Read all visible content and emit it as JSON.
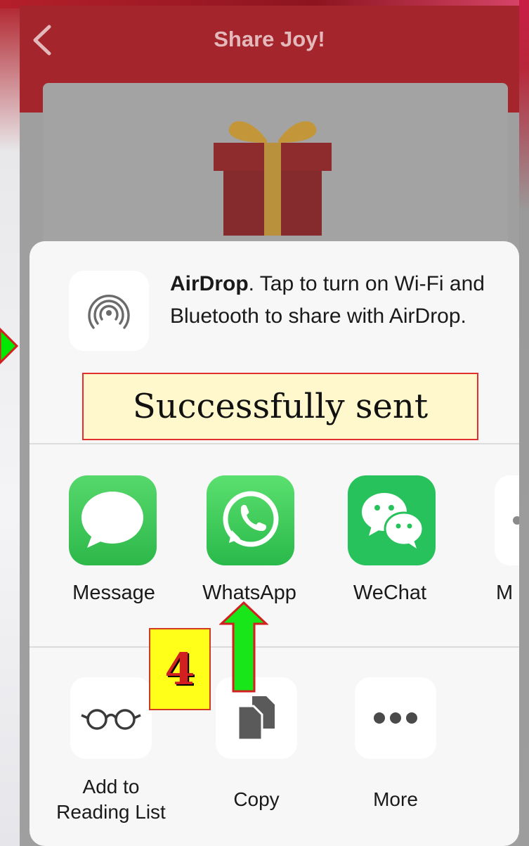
{
  "nav": {
    "title": "Share Joy!",
    "back_icon": "chevron-left-icon"
  },
  "sheet": {
    "airdrop": {
      "bold": "AirDrop",
      "text": ". Tap to turn on Wi-Fi and Bluetooth to share with AirDrop.",
      "icon": "airdrop-icon"
    },
    "apps": [
      {
        "label": "Message",
        "icon": "message-icon",
        "color": "#3dcc5a"
      },
      {
        "label": "WhatsApp",
        "icon": "whatsapp-icon",
        "color": "#34c84b"
      },
      {
        "label": "WeChat",
        "icon": "wechat-icon",
        "color": "#27c25b"
      },
      {
        "label": "M"
      }
    ],
    "actions": [
      {
        "label": "Add to Reading List",
        "icon": "glasses-icon"
      },
      {
        "label": "Copy",
        "icon": "copy-icon"
      },
      {
        "label": "More",
        "icon": "more-dots-icon"
      }
    ]
  },
  "annotations": {
    "success_text": "Successfully sent",
    "step_number": "4"
  },
  "colors": {
    "nav_red": "#a4252b",
    "accent_green": "#00e800",
    "highlight_yellow": "#ffff1a"
  }
}
